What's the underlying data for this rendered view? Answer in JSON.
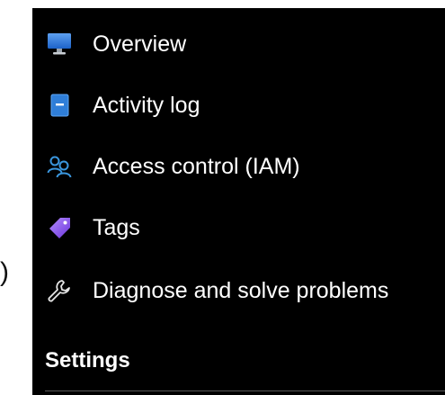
{
  "stray_text": ")",
  "nav": {
    "items": [
      {
        "label": "Overview",
        "icon": "monitor-icon"
      },
      {
        "label": "Activity log",
        "icon": "activity-log-icon"
      },
      {
        "label": "Access control (IAM)",
        "icon": "people-icon"
      },
      {
        "label": "Tags",
        "icon": "tag-icon"
      },
      {
        "label": "Diagnose and solve problems",
        "icon": "wrench-icon"
      }
    ]
  },
  "section": {
    "title": "Settings"
  },
  "colors": {
    "background": "#000000",
    "text": "#ffffff",
    "accent_blue": "#3a96dd",
    "tag_purple": "#8b5cf6"
  }
}
